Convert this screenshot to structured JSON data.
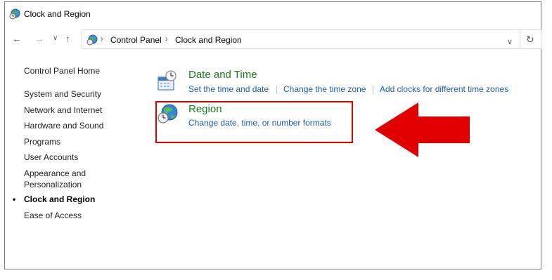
{
  "window": {
    "title": "Clock and Region"
  },
  "address_bar": {
    "crumbs": [
      "Control Panel",
      "Clock and Region"
    ]
  },
  "sidebar": {
    "items": [
      {
        "label": "Control Panel Home"
      },
      {
        "label": "System and Security"
      },
      {
        "label": "Network and Internet"
      },
      {
        "label": "Hardware and Sound"
      },
      {
        "label": "Programs"
      },
      {
        "label": "User Accounts"
      },
      {
        "label": "Appearance and"
      },
      {
        "label": "Personalization"
      },
      {
        "label": "Clock and Region",
        "active": true
      },
      {
        "label": "Ease of Access"
      }
    ]
  },
  "categories": [
    {
      "title": "Date and Time",
      "icon": "calendar-clock-icon",
      "links": [
        "Set the time and date",
        "Change the time zone",
        "Add clocks for different time zones"
      ]
    },
    {
      "title": "Region",
      "icon": "globe-clock-icon",
      "links": [
        "Change date, time, or number formats"
      ]
    }
  ],
  "colors": {
    "annotation": "#e00000",
    "category_title": "#1a7a1a",
    "link": "#1a5fa8"
  }
}
